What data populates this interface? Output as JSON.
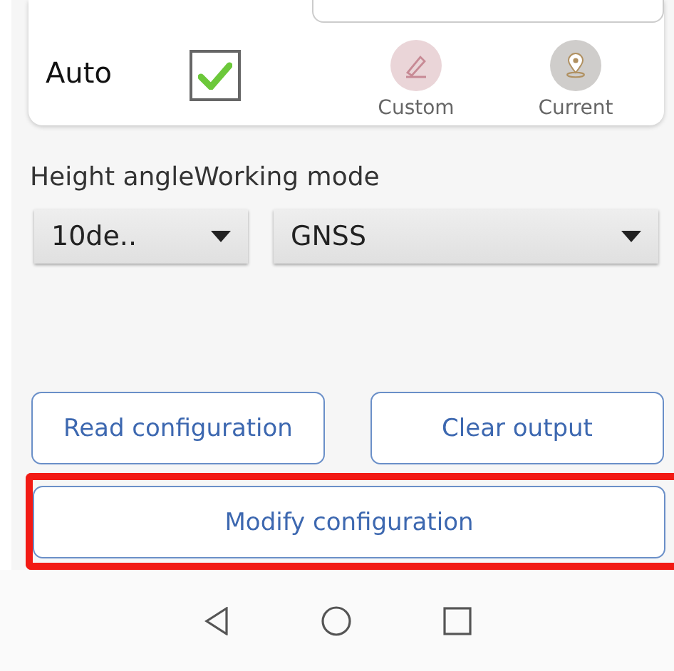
{
  "settings_card": {
    "auto": {
      "label": "Auto",
      "checked": true
    },
    "actions": [
      {
        "kind": "custom",
        "label": "Custom"
      },
      {
        "kind": "current",
        "label": "Current"
      }
    ]
  },
  "labels": [
    "Height angle",
    "Working mode"
  ],
  "dropdowns": [
    {
      "value": "10de.."
    },
    {
      "value": "GNSS"
    }
  ],
  "buttons": [
    {
      "label": "Read configuration"
    },
    {
      "label": "Clear output"
    }
  ],
  "modify_button": {
    "label": "Modify configuration",
    "highlighted": true
  }
}
